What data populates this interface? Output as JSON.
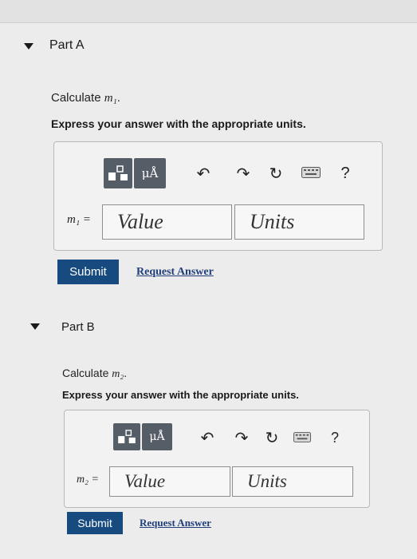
{
  "part_a": {
    "title": "Part A",
    "calculate_text": "Calculate ",
    "variable": "m₁",
    "suffix": ".",
    "instruction": "Express your answer with the appropriate units.",
    "toolbar": {
      "mu_label": "μÅ",
      "help_label": "?"
    },
    "input_label": "m₁ =",
    "value_placeholder": "Value",
    "units_placeholder": "Units",
    "submit_label": "Submit",
    "request_label": "Request Answer"
  },
  "part_b": {
    "title": "Part B",
    "calculate_text": "Calculate ",
    "variable": "m₂",
    "suffix": ".",
    "instruction": "Express your answer with the appropriate units.",
    "toolbar": {
      "mu_label": "μÅ",
      "help_label": "?"
    },
    "input_label": "m₂ =",
    "value_placeholder": "Value",
    "units_placeholder": "Units",
    "submit_label": "Submit",
    "request_label": "Request Answer"
  },
  "icons": [
    "chevron-down-icon",
    "templates-icon",
    "undo-icon",
    "redo-icon",
    "reset-icon",
    "keyboard-icon"
  ],
  "colors": {
    "submit_bg": "#174a7e",
    "toolbar_btn": "#555d66",
    "link": "#1f3e7a"
  }
}
